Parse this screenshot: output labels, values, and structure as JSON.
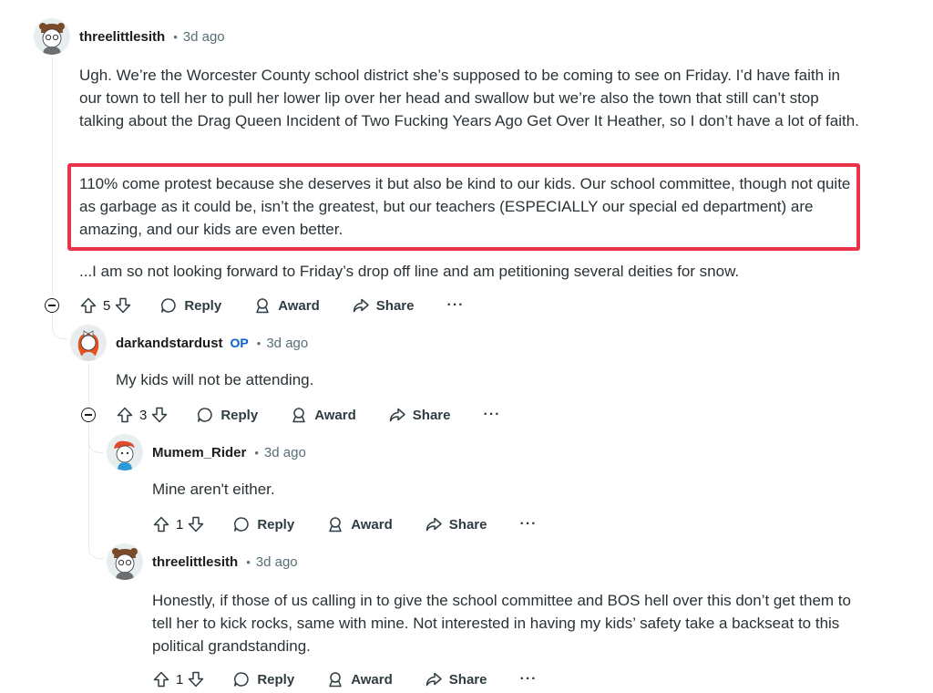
{
  "colors": {
    "highlight": "#ea3348",
    "op_badge": "#0a5fcf",
    "meta": "#576f76"
  },
  "comments": [
    {
      "username": "threelittlesith",
      "time": "3d ago",
      "avatar": "bear-hat-avatar",
      "paragraphs": [
        "Ugh. We’re the Worcester County school district she’s supposed to be coming to see on Friday. I’d have faith in our town to tell her to pull her lower lip over her head and swallow but we’re also the town that still can’t stop talking about the Drag Queen Incident of Two Fucking Years Ago Get Over It Heather, so I don’t have a lot of faith.",
        "110% come protest because she deserves it but also be kind to our kids. Our school committee, though not quite as garbage as it could be, isn’t the greatest, but our teachers (ESPECIALLY our special ed department) are amazing, and our kids are even better.",
        "...I am so not looking forward to Friday’s drop off line and am petitioning several deities for snow."
      ],
      "votes": "5",
      "reply": "Reply",
      "award": "Award",
      "share": "Share",
      "more": "···"
    },
    {
      "username": "darkandstardust",
      "op": "OP",
      "time": "3d ago",
      "avatar": "red-hair-bow-avatar",
      "paragraphs": [
        "My kids will not be attending."
      ],
      "votes": "3",
      "reply": "Reply",
      "award": "Award",
      "share": "Share",
      "more": "···"
    },
    {
      "username": "Mumem_Rider",
      "time": "3d ago",
      "avatar": "pirate-bandana-avatar",
      "paragraphs": [
        "Mine aren't either."
      ],
      "votes": "1",
      "reply": "Reply",
      "award": "Award",
      "share": "Share",
      "more": "···"
    },
    {
      "username": "threelittlesith",
      "time": "3d ago",
      "avatar": "bear-hat-avatar",
      "paragraphs": [
        "Honestly, if those of us calling in to give the school committee and BOS hell over this don’t get them to tell her to kick rocks, same with mine. Not interested in having my kids’ safety take a backseat to this political grandstanding."
      ],
      "votes": "1",
      "reply": "Reply",
      "award": "Award",
      "share": "Share",
      "more": "···"
    }
  ]
}
